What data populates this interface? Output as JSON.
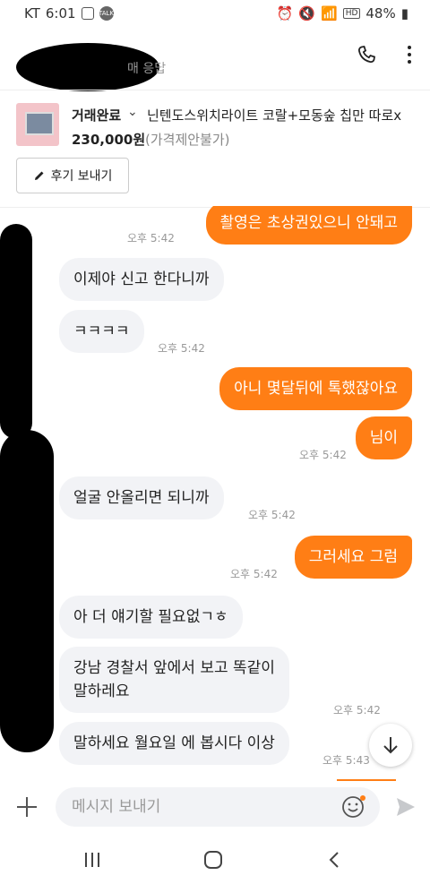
{
  "status_bar": {
    "carrier": "KT",
    "time": "6:01",
    "battery": "48%",
    "hd_label": "HD"
  },
  "header": {
    "response_text": "매 응답"
  },
  "product": {
    "status": "거래완료",
    "title": "닌텐도스위치라이트 코랄+모동숲 칩만 따로x",
    "price": "230,000원",
    "price_note": "(가격제안불가)",
    "review_button": "후기 보내기"
  },
  "messages": [
    {
      "sender": "me",
      "text": "촬영은 초상권있으니 안돼고",
      "time": "오후 5:42"
    },
    {
      "sender": "other",
      "text": "이제야 신고 한다니까",
      "time": ""
    },
    {
      "sender": "other",
      "text": "ㅋㅋㅋㅋ",
      "time": "오후 5:42"
    },
    {
      "sender": "me",
      "text": "아니 몇달뒤에 톡했잖아요",
      "time": ""
    },
    {
      "sender": "me",
      "text": "님이",
      "time": "오후 5:42"
    },
    {
      "sender": "other",
      "text": "얼굴 안올리면 되니까",
      "time": "오후 5:42"
    },
    {
      "sender": "me",
      "text": "그러세요 그럼",
      "time": "오후 5:42"
    },
    {
      "sender": "other",
      "text": "아 더 얘기할 필요없ㄱㅎ",
      "time": ""
    },
    {
      "sender": "other",
      "text": "강남 경찰서 앞에서 보고 똑같이\n말하레요",
      "time": "오후 5:42"
    },
    {
      "sender": "other",
      "text": "말하세요 월요일 에 봅시다 이상",
      "time": "오후 5:43"
    }
  ],
  "input": {
    "placeholder": "메시지 보내기"
  },
  "colors": {
    "accent": "#ff7e15",
    "bubble_other": "#f2f3f6"
  }
}
